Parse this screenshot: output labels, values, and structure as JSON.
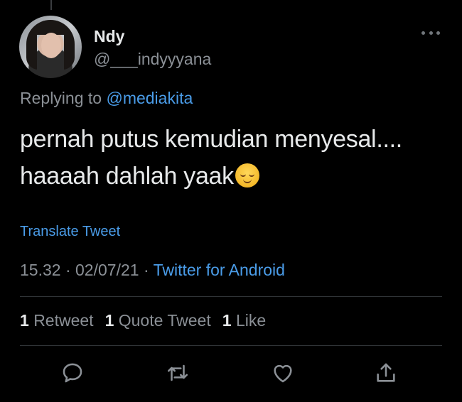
{
  "user": {
    "name": "Ndy",
    "handle": "@___indyyyana"
  },
  "reply": {
    "prefix": "Replying to",
    "to": "@mediakita"
  },
  "tweet": {
    "line1": "pernah putus kemudian menyesal....",
    "line2": "haaaah dahlah yaak",
    "emoji": "relieved-face-emoji"
  },
  "translate_label": "Translate Tweet",
  "meta": {
    "time": "15.32",
    "sep1": "·",
    "date": "02/07/21",
    "sep2": "·",
    "source": "Twitter for Android"
  },
  "stats": {
    "retweets_count": "1",
    "retweets_label": "Retweet",
    "quotes_count": "1",
    "quotes_label": "Quote Tweet",
    "likes_count": "1",
    "likes_label": "Like"
  },
  "actions": [
    "reply-icon",
    "retweet-icon",
    "like-icon",
    "share-icon"
  ],
  "colors": {
    "background": "#000000",
    "text": "#e7e9ea",
    "secondary": "#8b9096",
    "link": "#4a9ce8",
    "divider": "#2f3336"
  }
}
